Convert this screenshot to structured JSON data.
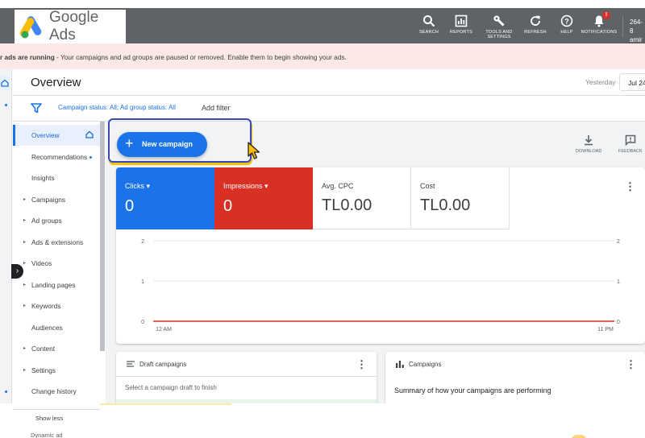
{
  "app": {
    "name": "Google Ads"
  },
  "toolbar": {
    "items": [
      {
        "label": "SEARCH",
        "icon": "search-icon"
      },
      {
        "label": "REPORTS",
        "icon": "reports-icon"
      },
      {
        "label": "TOOLS AND SETTINGS",
        "icon": "wrench-icon"
      },
      {
        "label": "REFRESH",
        "icon": "refresh-icon"
      },
      {
        "label": "HELP",
        "icon": "help-icon"
      },
      {
        "label": "NOTIFICATIONS",
        "icon": "bell-icon"
      }
    ],
    "notification_count": "!",
    "account_line1": "264-8",
    "account_line2": "amir"
  },
  "banner": {
    "bold": "r ads are running",
    "text": " - Your campaigns and ad groups are paused or removed. Enable them to begin showing your ads."
  },
  "header": {
    "title": "Overview",
    "date_label": "Yesterday",
    "date_value": "Jul 24"
  },
  "filters": {
    "status_text": "Campaign status: All; Ad group status: All",
    "add_filter": "Add filter"
  },
  "nav": {
    "items": [
      {
        "label": "Overview",
        "active": true,
        "caret": false,
        "dot": false
      },
      {
        "label": "Recommendations",
        "active": false,
        "caret": false,
        "dot": true
      },
      {
        "label": "Insights",
        "active": false,
        "caret": false,
        "dot": false
      },
      {
        "label": "Campaigns",
        "active": false,
        "caret": true,
        "dot": false
      },
      {
        "label": "Ad groups",
        "active": false,
        "caret": true,
        "dot": false
      },
      {
        "label": "Ads & extensions",
        "active": false,
        "caret": true,
        "dot": false
      },
      {
        "label": "Videos",
        "active": false,
        "caret": true,
        "dot": false
      },
      {
        "label": "Landing pages",
        "active": false,
        "caret": true,
        "dot": false
      },
      {
        "label": "Keywords",
        "active": false,
        "caret": true,
        "dot": false
      },
      {
        "label": "Audiences",
        "active": false,
        "caret": false,
        "dot": false
      },
      {
        "label": "Content",
        "active": false,
        "caret": true,
        "dot": false
      },
      {
        "label": "Settings",
        "active": false,
        "caret": true,
        "dot": false
      },
      {
        "label": "Change history",
        "active": false,
        "caret": false,
        "dot": false
      }
    ],
    "show_less": "Show less",
    "dynamic_ad": "Dynamic ad"
  },
  "actions": {
    "new_campaign": "New campaign",
    "download": "DOWNLOAD",
    "feedback": "FEEDBACK"
  },
  "metrics": {
    "clicks": {
      "label": "Clicks",
      "value": "0"
    },
    "impressions": {
      "label": "Impressions",
      "value": "0"
    },
    "avg_cpc": {
      "label": "Avg. CPC",
      "value": "TL0.00"
    },
    "cost": {
      "label": "Cost",
      "value": "TL0.00"
    }
  },
  "chart_data": {
    "type": "line",
    "x_tick_labels": [
      "12 AM",
      "11 PM"
    ],
    "y_ticks_left": [
      "2",
      "1",
      "0"
    ],
    "y_ticks_right": [
      "2",
      "1",
      "0"
    ],
    "ylim": [
      0,
      2
    ],
    "series": [
      {
        "name": "Clicks",
        "color": "#1a73e8",
        "values": [
          0,
          0
        ]
      },
      {
        "name": "Impressions",
        "color": "#d93025",
        "values": [
          0,
          0
        ]
      }
    ]
  },
  "cards": {
    "draft_title": "Draft campaigns",
    "draft_text": "Select a campaign draft to finish",
    "campaigns_title": "Campaigns",
    "campaigns_text": "Summary of how your campaigns are performing"
  },
  "colors": {
    "brand_blue": "#1a73e8",
    "brand_red": "#d93025",
    "topbar": "#5f6368",
    "banner": "#fce8e6"
  }
}
